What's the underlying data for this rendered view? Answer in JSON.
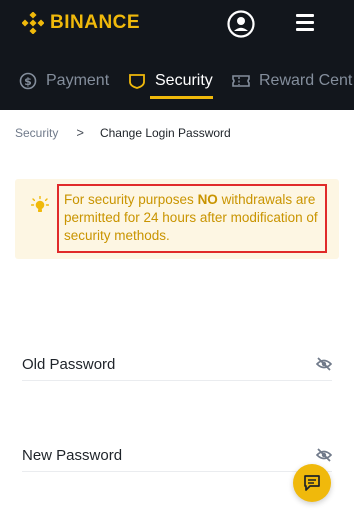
{
  "header": {
    "logo_text": "BINANCE",
    "account_icon": "user-circle-icon",
    "menu_icon": "hamburger-menu-icon"
  },
  "tabs": [
    {
      "label": "Payment",
      "icon": "dollar-circle-icon",
      "active": false
    },
    {
      "label": "Security",
      "icon": "shield-icon",
      "active": true
    },
    {
      "label": "Reward Cent",
      "icon": "ticket-icon",
      "active": false
    }
  ],
  "breadcrumb": {
    "parent": "Security",
    "separator": ">",
    "current": "Change Login Password"
  },
  "notice": {
    "icon": "lightbulb-icon",
    "text_before": "For security purposes ",
    "text_bold": "NO",
    "text_after": " withdrawals are permitted for 24 hours after modification of security methods."
  },
  "form": {
    "old_password_label": "Old Password",
    "new_password_label": "New Password",
    "toggle_icon": "eye-off-icon"
  },
  "chat": {
    "icon": "chat-icon"
  },
  "colors": {
    "brand": "#f0b90b",
    "header_bg": "#12161c",
    "notice_bg": "#fdf6e3",
    "notice_text": "#c99400",
    "highlight_border": "#e02a2a"
  }
}
